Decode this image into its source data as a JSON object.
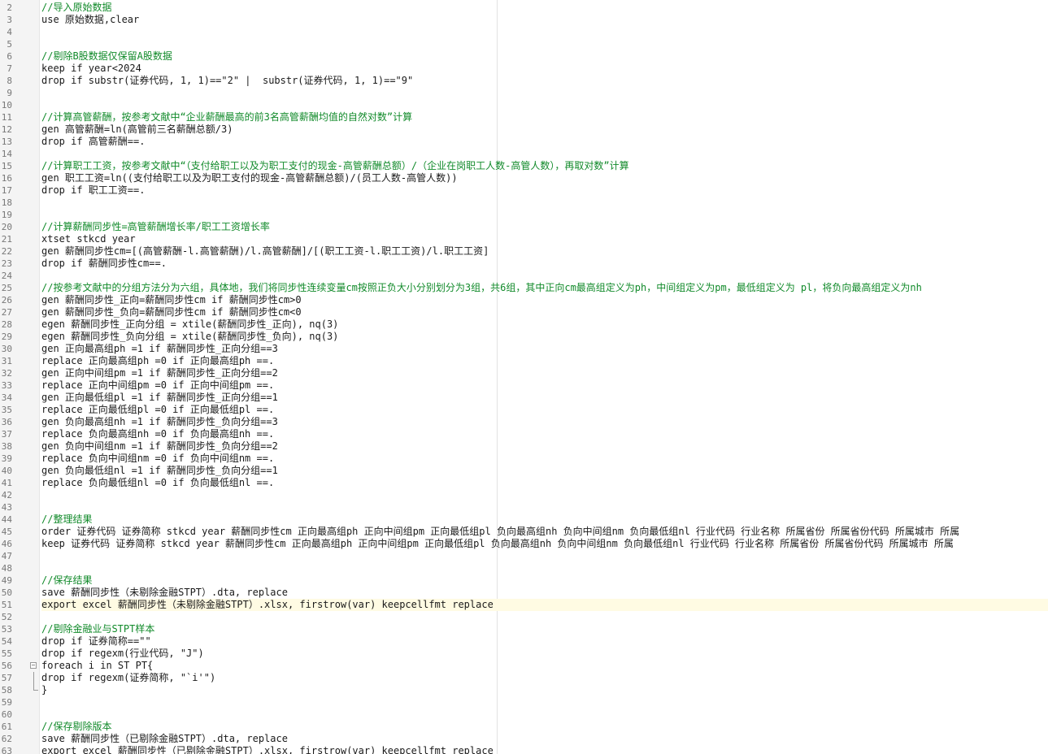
{
  "editor": {
    "lines": [
      {
        "n": "2",
        "text": "//导入原始数据",
        "kind": "comment"
      },
      {
        "n": "3",
        "text": "use 原始数据,clear",
        "kind": "code"
      },
      {
        "n": "4",
        "text": "",
        "kind": "code"
      },
      {
        "n": "5",
        "text": "",
        "kind": "code"
      },
      {
        "n": "6",
        "text": "//剔除B股数据仅保留A股数据",
        "kind": "comment"
      },
      {
        "n": "7",
        "text": "keep if year<2024",
        "kind": "code"
      },
      {
        "n": "8",
        "text": "drop if substr(证券代码, 1, 1)==\"2\" |  substr(证券代码, 1, 1)==\"9\"",
        "kind": "code"
      },
      {
        "n": "9",
        "text": "",
        "kind": "code"
      },
      {
        "n": "10",
        "text": "",
        "kind": "code"
      },
      {
        "n": "11",
        "text": "//计算高管薪酬，按参考文献中“企业薪酬最高的前3名高管薪酬均值的自然对数”计算",
        "kind": "comment"
      },
      {
        "n": "12",
        "text": "gen 高管薪酬=ln(高管前三名薪酬总额/3)",
        "kind": "code"
      },
      {
        "n": "13",
        "text": "drop if 高管薪酬==.",
        "kind": "code"
      },
      {
        "n": "14",
        "text": "",
        "kind": "code"
      },
      {
        "n": "15",
        "text": "//计算职工工资，按参考文献中“（支付给职工以及为职工支付的现金-高管薪酬总额）/（企业在岗职工人数-高管人数），再取对数”计算",
        "kind": "comment"
      },
      {
        "n": "16",
        "text": "gen 职工工资=ln((支付给职工以及为职工支付的现金-高管薪酬总额)/(员工人数-高管人数))",
        "kind": "code"
      },
      {
        "n": "17",
        "text": "drop if 职工工资==.",
        "kind": "code"
      },
      {
        "n": "18",
        "text": "",
        "kind": "code"
      },
      {
        "n": "19",
        "text": "",
        "kind": "code"
      },
      {
        "n": "20",
        "text": "//计算薪酬同步性=高管薪酬增长率/职工工资增长率",
        "kind": "comment"
      },
      {
        "n": "21",
        "text": "xtset stkcd year",
        "kind": "code"
      },
      {
        "n": "22",
        "text": "gen 薪酬同步性cm=[(高管薪酬-l.高管薪酬)/l.高管薪酬]/[(职工工资-l.职工工资)/l.职工工资]",
        "kind": "code"
      },
      {
        "n": "23",
        "text": "drop if 薪酬同步性cm==.",
        "kind": "code"
      },
      {
        "n": "24",
        "text": "",
        "kind": "code"
      },
      {
        "n": "25",
        "text": "//按参考文献中的分组方法分为六组，具体地，我们将同步性连续变量cm按照正负大小分别划分为3组，共6组，其中正向cm最高组定义为ph，中间组定义为pm，最低组定义为 pl，将负向最高组定义为nh",
        "kind": "comment"
      },
      {
        "n": "26",
        "text": "gen 薪酬同步性_正向=薪酬同步性cm if 薪酬同步性cm>0",
        "kind": "code"
      },
      {
        "n": "27",
        "text": "gen 薪酬同步性_负向=薪酬同步性cm if 薪酬同步性cm<0",
        "kind": "code"
      },
      {
        "n": "28",
        "text": "egen 薪酬同步性_正向分组 = xtile(薪酬同步性_正向), nq(3)",
        "kind": "code"
      },
      {
        "n": "29",
        "text": "egen 薪酬同步性_负向分组 = xtile(薪酬同步性_负向), nq(3)",
        "kind": "code"
      },
      {
        "n": "30",
        "text": "gen 正向最高组ph =1 if 薪酬同步性_正向分组==3",
        "kind": "code"
      },
      {
        "n": "31",
        "text": "replace 正向最高组ph =0 if 正向最高组ph ==.",
        "kind": "code"
      },
      {
        "n": "32",
        "text": "gen 正向中间组pm =1 if 薪酬同步性_正向分组==2",
        "kind": "code"
      },
      {
        "n": "33",
        "text": "replace 正向中间组pm =0 if 正向中间组pm ==.",
        "kind": "code"
      },
      {
        "n": "34",
        "text": "gen 正向最低组pl =1 if 薪酬同步性_正向分组==1",
        "kind": "code"
      },
      {
        "n": "35",
        "text": "replace 正向最低组pl =0 if 正向最低组pl ==.",
        "kind": "code"
      },
      {
        "n": "36",
        "text": "gen 负向最高组nh =1 if 薪酬同步性_负向分组==3",
        "kind": "code"
      },
      {
        "n": "37",
        "text": "replace 负向最高组nh =0 if 负向最高组nh ==.",
        "kind": "code"
      },
      {
        "n": "38",
        "text": "gen 负向中间组nm =1 if 薪酬同步性_负向分组==2",
        "kind": "code"
      },
      {
        "n": "39",
        "text": "replace 负向中间组nm =0 if 负向中间组nm ==.",
        "kind": "code"
      },
      {
        "n": "40",
        "text": "gen 负向最低组nl =1 if 薪酬同步性_负向分组==1",
        "kind": "code"
      },
      {
        "n": "41",
        "text": "replace 负向最低组nl =0 if 负向最低组nl ==.",
        "kind": "code"
      },
      {
        "n": "42",
        "text": "",
        "kind": "code"
      },
      {
        "n": "43",
        "text": "",
        "kind": "code"
      },
      {
        "n": "44",
        "text": "//整理结果",
        "kind": "comment"
      },
      {
        "n": "45",
        "text": "order 证券代码 证券简称 stkcd year 薪酬同步性cm 正向最高组ph 正向中间组pm 正向最低组pl 负向最高组nh 负向中间组nm 负向最低组nl 行业代码 行业名称 所属省份 所属省份代码 所属城市 所属",
        "kind": "code"
      },
      {
        "n": "46",
        "text": "keep 证券代码 证券简称 stkcd year 薪酬同步性cm 正向最高组ph 正向中间组pm 正向最低组pl 负向最高组nh 负向中间组nm 负向最低组nl 行业代码 行业名称 所属省份 所属省份代码 所属城市 所属",
        "kind": "code"
      },
      {
        "n": "47",
        "text": "",
        "kind": "code"
      },
      {
        "n": "48",
        "text": "",
        "kind": "code"
      },
      {
        "n": "49",
        "text": "//保存结果",
        "kind": "comment"
      },
      {
        "n": "50",
        "text": "save 薪酬同步性（未剔除金融STPT）.dta, replace",
        "kind": "code"
      },
      {
        "n": "51",
        "text": "export excel 薪酬同步性（未剔除金融STPT）.xlsx, firstrow(var) keepcellfmt replace",
        "kind": "code",
        "current": true
      },
      {
        "n": "52",
        "text": "",
        "kind": "code"
      },
      {
        "n": "53",
        "text": "//剔除金融业与STPT样本",
        "kind": "comment"
      },
      {
        "n": "54",
        "text": "drop if 证券简称==\"\"",
        "kind": "code"
      },
      {
        "n": "55",
        "text": "drop if regexm(行业代码, \"J\")",
        "kind": "code"
      },
      {
        "n": "56",
        "text": "foreach i in ST PT{",
        "kind": "code",
        "fold": "start"
      },
      {
        "n": "57",
        "text": "drop if regexm(证券简称, \"`i'\")",
        "kind": "code",
        "fold": "mid"
      },
      {
        "n": "58",
        "text": "}",
        "kind": "code",
        "fold": "end"
      },
      {
        "n": "59",
        "text": "",
        "kind": "code"
      },
      {
        "n": "60",
        "text": "",
        "kind": "code"
      },
      {
        "n": "61",
        "text": "//保存剔除版本",
        "kind": "comment"
      },
      {
        "n": "62",
        "text": "save 薪酬同步性（已剔除金融STPT）.dta, replace",
        "kind": "code"
      },
      {
        "n": "63",
        "text": "export excel 薪酬同步性（已剔除金融STPT）.xlsx, firstrow(var) keepcellfmt replace",
        "kind": "code"
      }
    ],
    "fold_marker": "−"
  }
}
